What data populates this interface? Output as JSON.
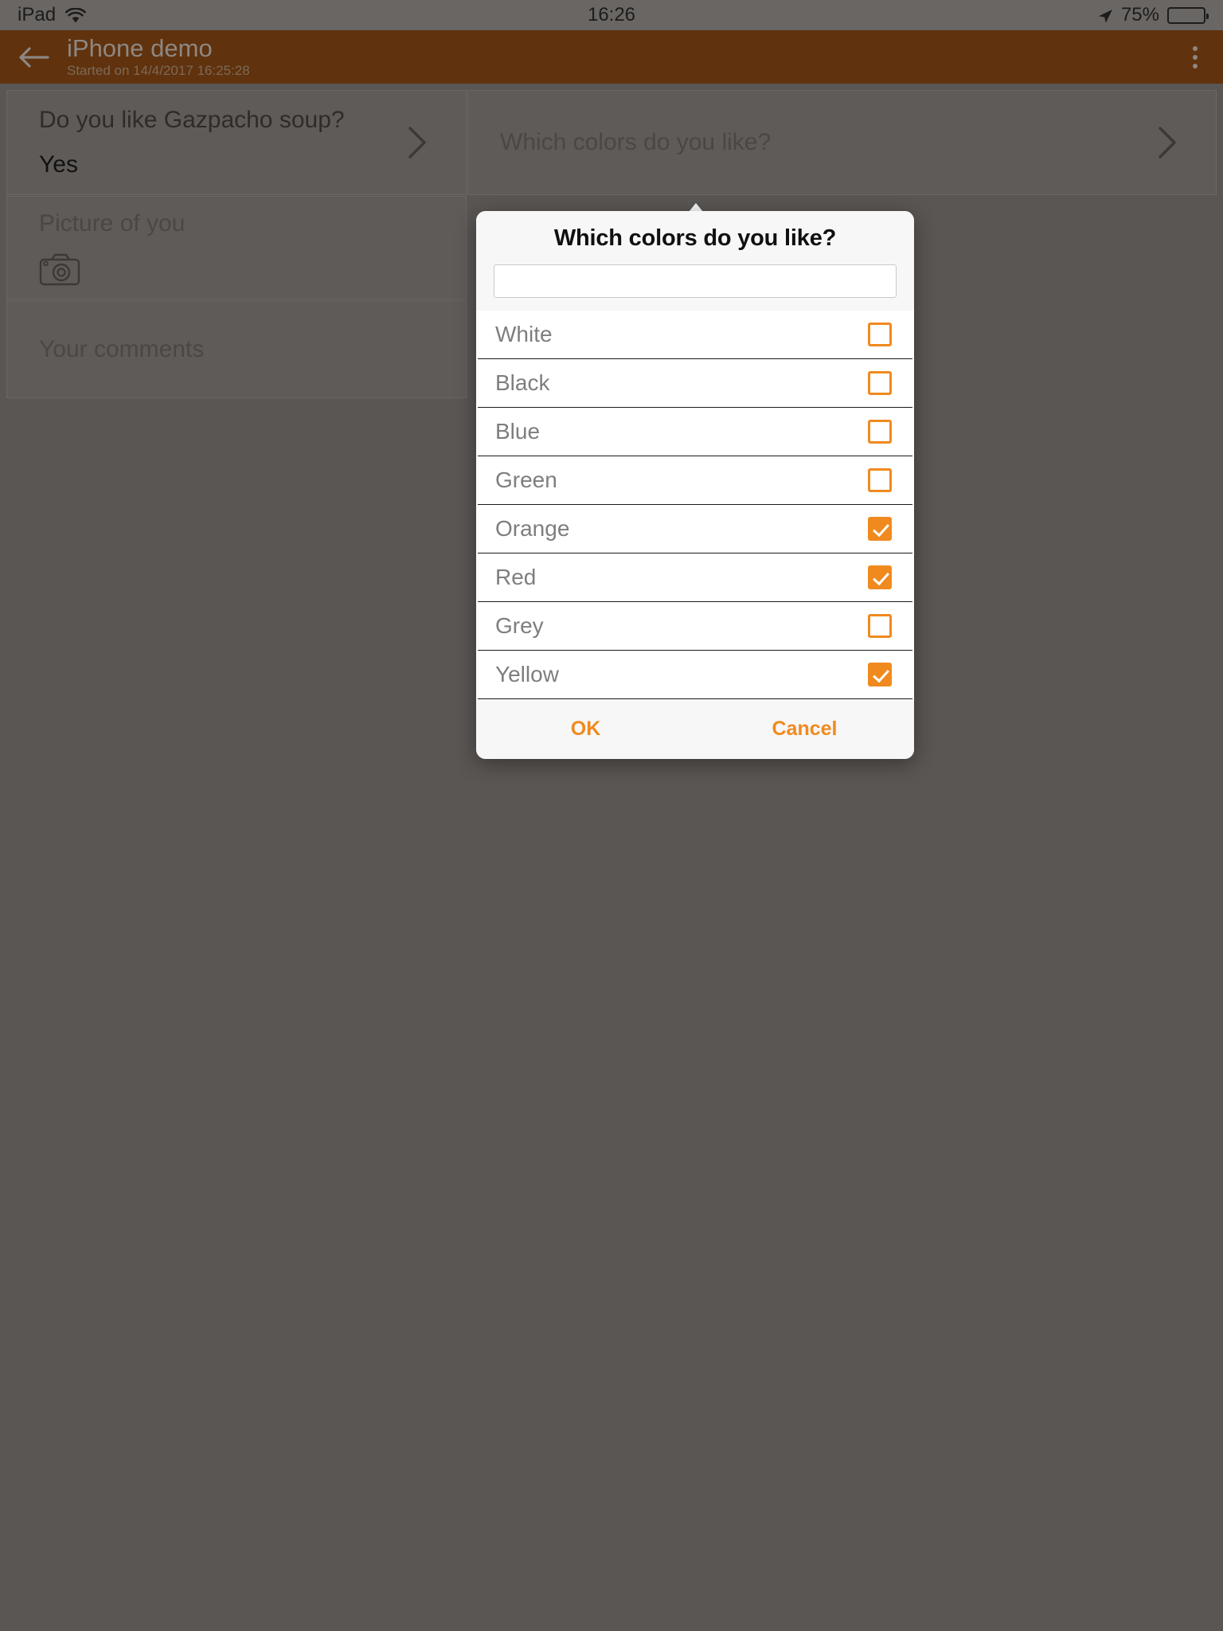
{
  "statusbar": {
    "carrier": "iPad",
    "wifi_icon": "wifi-icon",
    "time": "16:26",
    "location_icon": "location-arrow-icon",
    "battery_percent": "75%",
    "battery_level": 75,
    "battery_icon": "battery-icon"
  },
  "appbar": {
    "back_icon": "back-arrow-icon",
    "title": "iPhone demo",
    "subtitle": "Started on 14/4/2017 16:25:28",
    "overflow_icon": "overflow-menu-icon",
    "background_color": "#60320d"
  },
  "form": {
    "cards": [
      {
        "id": "soup",
        "question": "Do you like Gazpacho soup?",
        "answer": "Yes",
        "chevron_icon": "chevron-right-icon"
      },
      {
        "id": "picture",
        "question": "Picture of you",
        "answer": "",
        "media_icon": "camera-icon"
      },
      {
        "id": "comments",
        "question": "Your comments",
        "answer": ""
      },
      {
        "id": "colors",
        "question": "Which colors do you like?",
        "answer": "",
        "chevron_icon": "chevron-right-icon"
      }
    ]
  },
  "dialog": {
    "title": "Which colors do you like?",
    "search_value": "",
    "search_placeholder": "",
    "accent_color": "#f08a1e",
    "options": [
      {
        "label": "White",
        "checked": false
      },
      {
        "label": "Black",
        "checked": false
      },
      {
        "label": "Blue",
        "checked": false
      },
      {
        "label": "Green",
        "checked": false
      },
      {
        "label": "Orange",
        "checked": true
      },
      {
        "label": "Red",
        "checked": true
      },
      {
        "label": "Grey",
        "checked": false
      },
      {
        "label": "Yellow",
        "checked": true
      }
    ],
    "ok_label": "OK",
    "cancel_label": "Cancel"
  }
}
